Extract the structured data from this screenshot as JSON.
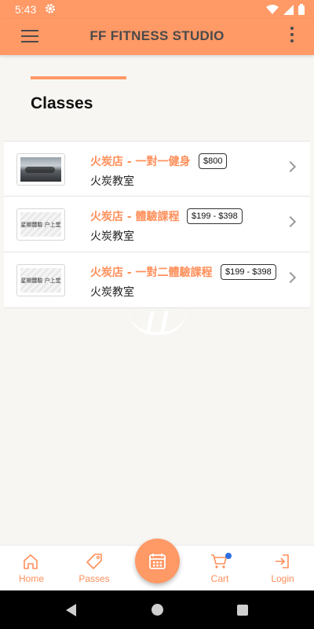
{
  "status_bar": {
    "time": "5:43",
    "icons": [
      "gear-icon",
      "wifi-icon",
      "signal-icon",
      "battery-icon"
    ]
  },
  "app_bar": {
    "title": "FF FITNESS STUDIO",
    "menu_icon": "hamburger-menu-icon",
    "more_icon": "more-vertical-icon"
  },
  "section": {
    "title": "Classes"
  },
  "classes": [
    {
      "title": "火炭店 - 一對一健身",
      "price": "$800",
      "location": "火炭教室",
      "thumb_text": ""
    },
    {
      "title": "火炭店 - 體驗課程",
      "price": "$199 - $398",
      "location": "火炭教室",
      "thumb_text": "星期體驗 户上堂"
    },
    {
      "title": "火炭店 - 一對二體驗課程",
      "price": "$199 - $398",
      "location": "火炭教室",
      "thumb_text": "星期體驗 户上堂"
    }
  ],
  "bottom_nav": {
    "home": "Home",
    "passes": "Passes",
    "cart": "Cart",
    "login": "Login",
    "fab_icon": "calendar-icon"
  },
  "colors": {
    "primary": "#ff9966",
    "accent_text": "#ff8f5a",
    "cart_badge": "#2f6fe4",
    "background": "#f7f6f2"
  }
}
